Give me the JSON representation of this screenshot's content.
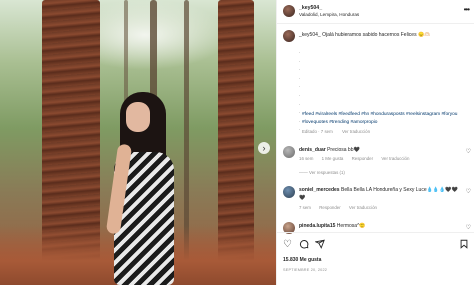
{
  "post": {
    "username": "_key504_",
    "location": "Valadolid, Lempira, Honduras",
    "caption": "_key504_ Ojalá hubieramos sabido hacernos Felices 😞🫶🏻",
    "caption_dots": ".\n.\n.\n.\n.\n.\n.\n.\n.\n.",
    "hashtags": "#feed #viralreels #feedfeed #hn #hondurasposts #reelsinstagram #foryou #lovequotes #trending #amorpropio",
    "meta_time": "Editado · 7 sem",
    "meta_translation": "Ver traducción"
  },
  "comments": [
    {
      "user": "denis_duar",
      "text": "Preciosa bb🖤",
      "time": "16 sem",
      "likes": "1 Me gusta",
      "reply": "Responder",
      "translate": "Ver traducción",
      "replies": "Ver respuestas (1)"
    },
    {
      "user": "soniel_mercedes",
      "text": "Bella Bella LA Hondureña y Sexy Luce💧💧💧🖤🖤🖤",
      "time": "7 sem",
      "reply": "Responder",
      "translate": "Ver traducción"
    },
    {
      "user": "pineda.lupita15",
      "text": "Hermosa^🙂"
    }
  ],
  "footer": {
    "likes": "15.830 Me gusta",
    "date": "SEPTIEMBRE 20, 2022"
  },
  "icons": {
    "more": "more-icon",
    "like": "heart-icon",
    "comment": "comment-icon",
    "share": "share-icon",
    "save": "bookmark-icon",
    "next": "chevron-right-icon"
  }
}
